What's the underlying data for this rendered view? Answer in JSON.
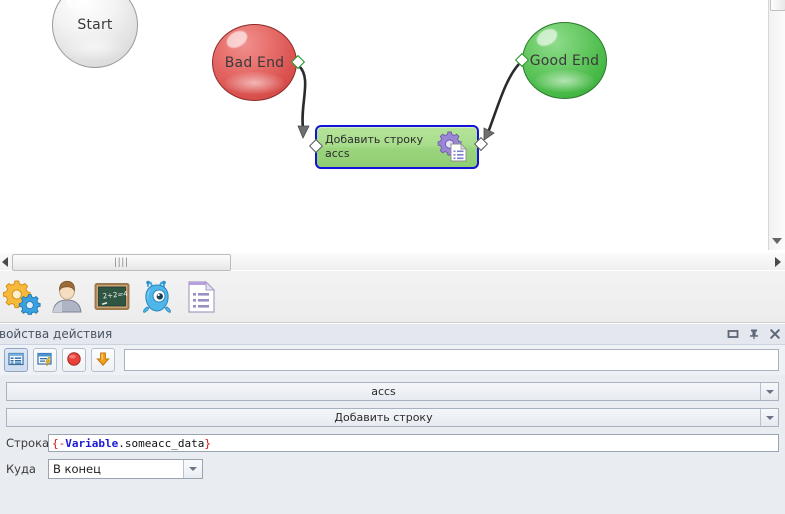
{
  "canvas": {
    "nodes": [
      {
        "id": "start",
        "label": "Start",
        "kind": "circle-gray"
      },
      {
        "id": "bad-end",
        "label": "Bad End",
        "kind": "circle-red"
      },
      {
        "id": "good-end",
        "label": "Good End",
        "kind": "circle-green"
      },
      {
        "id": "action",
        "label": "Добавить строку\naccs",
        "kind": "rect-action",
        "icon": "gear-document-icon"
      }
    ],
    "scroll": {
      "horizontal_grip": "||||",
      "left_arrow_icon": "arrow-left-icon",
      "right_arrow_icon": "arrow-right-icon",
      "down_arrow_icon": "arrow-down-icon"
    }
  },
  "icon_toolbar": {
    "items": [
      {
        "name": "gears-icon",
        "title": "gears"
      },
      {
        "name": "user-icon",
        "title": "user"
      },
      {
        "name": "blackboard-icon",
        "title": "blackboard",
        "text": "2+2=4"
      },
      {
        "name": "monster-icon",
        "title": "monster"
      },
      {
        "name": "document-list-icon",
        "title": "document list"
      }
    ]
  },
  "properties_panel": {
    "title": "войства действия",
    "window_controls": [
      {
        "name": "maximize-icon"
      },
      {
        "name": "pin-icon"
      },
      {
        "name": "close-icon"
      }
    ],
    "toolbar_buttons": [
      {
        "name": "table-view-button",
        "icon": "table-icon",
        "active": true
      },
      {
        "name": "window-run-button",
        "icon": "window-bolt-icon",
        "active": false
      },
      {
        "name": "record-button",
        "icon": "red-circle-icon",
        "active": false
      },
      {
        "name": "download-button",
        "icon": "orange-down-arrow-icon",
        "active": false
      }
    ],
    "search_input": {
      "value": "",
      "placeholder": ""
    },
    "combo_object": {
      "value": "accs",
      "arrow_icon": "chevron-down-icon"
    },
    "combo_action": {
      "value": "Добавить строку",
      "arrow_icon": "chevron-down-icon"
    },
    "field_string": {
      "label": "Строка",
      "value": "{-Variable.someacc_data}",
      "tokens": [
        {
          "text": "{-",
          "kind": "brace"
        },
        {
          "text": "Variable",
          "kind": "var"
        },
        {
          "text": ".someacc_data",
          "kind": "plain"
        },
        {
          "text": "}",
          "kind": "brace"
        }
      ]
    },
    "field_where": {
      "label": "Куда",
      "value": "В конец",
      "arrow_icon": "chevron-down-icon"
    }
  },
  "colors": {
    "accent_blue": "#1414d8",
    "node_red": "#d9504d",
    "node_green": "#45b845",
    "action_green": "#9ad47c",
    "panel_bg": "#e9ecf1",
    "token_red": "#d21010",
    "token_blue": "#1a1ad2"
  }
}
